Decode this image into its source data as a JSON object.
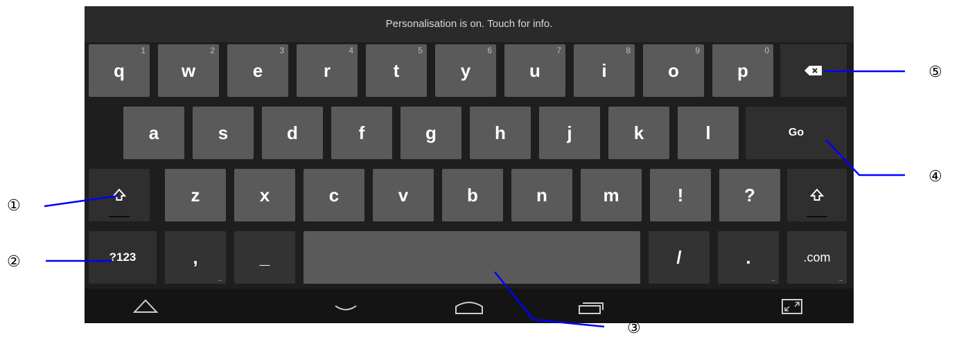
{
  "banner": "Personalisation is on. Touch for info.",
  "row1": [
    {
      "label": "q",
      "hint": "1"
    },
    {
      "label": "w",
      "hint": "2"
    },
    {
      "label": "e",
      "hint": "3"
    },
    {
      "label": "r",
      "hint": "4"
    },
    {
      "label": "t",
      "hint": "5"
    },
    {
      "label": "y",
      "hint": "6"
    },
    {
      "label": "u",
      "hint": "7"
    },
    {
      "label": "i",
      "hint": "8"
    },
    {
      "label": "o",
      "hint": "9"
    },
    {
      "label": "p",
      "hint": "0"
    }
  ],
  "row2": [
    "a",
    "s",
    "d",
    "f",
    "g",
    "h",
    "j",
    "k",
    "l"
  ],
  "row3": [
    "z",
    "x",
    "c",
    "v",
    "b",
    "n",
    "m",
    "!",
    "?"
  ],
  "keys": {
    "go": "Go",
    "sym": "?123",
    "comma": ",",
    "underscore": "_",
    "slash": "/",
    "period": ".",
    "dotcom": ".com",
    "dots": "..."
  },
  "icons": {
    "backspace": "backspace-icon",
    "shift": "shift-icon",
    "hide_keyboard": "hide-keyboard-icon",
    "back": "back-icon",
    "home": "home-icon",
    "recents": "recent-apps-icon",
    "resize": "resize-icon"
  },
  "callouts": {
    "c1": "①",
    "c2": "②",
    "c3": "③",
    "c4": "④",
    "c5": "⑤"
  },
  "colors": {
    "key": "#5a5a5a",
    "func_key": "#2f2f2f",
    "background": "#1b1b1b",
    "callout_line": "#0000ff"
  }
}
